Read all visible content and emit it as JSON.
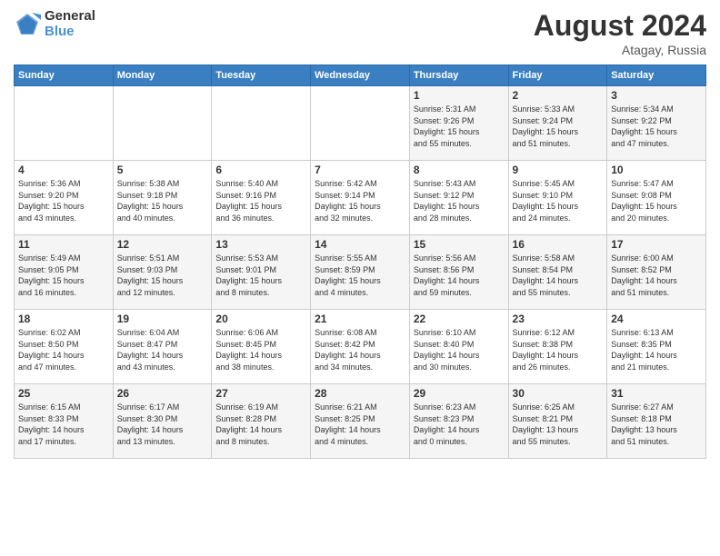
{
  "header": {
    "logo_general": "General",
    "logo_blue": "Blue",
    "month_year": "August 2024",
    "location": "Atagay, Russia"
  },
  "weekdays": [
    "Sunday",
    "Monday",
    "Tuesday",
    "Wednesday",
    "Thursday",
    "Friday",
    "Saturday"
  ],
  "weeks": [
    [
      {
        "day": "",
        "info": ""
      },
      {
        "day": "",
        "info": ""
      },
      {
        "day": "",
        "info": ""
      },
      {
        "day": "",
        "info": ""
      },
      {
        "day": "1",
        "info": "Sunrise: 5:31 AM\nSunset: 9:26 PM\nDaylight: 15 hours\nand 55 minutes."
      },
      {
        "day": "2",
        "info": "Sunrise: 5:33 AM\nSunset: 9:24 PM\nDaylight: 15 hours\nand 51 minutes."
      },
      {
        "day": "3",
        "info": "Sunrise: 5:34 AM\nSunset: 9:22 PM\nDaylight: 15 hours\nand 47 minutes."
      }
    ],
    [
      {
        "day": "4",
        "info": "Sunrise: 5:36 AM\nSunset: 9:20 PM\nDaylight: 15 hours\nand 43 minutes."
      },
      {
        "day": "5",
        "info": "Sunrise: 5:38 AM\nSunset: 9:18 PM\nDaylight: 15 hours\nand 40 minutes."
      },
      {
        "day": "6",
        "info": "Sunrise: 5:40 AM\nSunset: 9:16 PM\nDaylight: 15 hours\nand 36 minutes."
      },
      {
        "day": "7",
        "info": "Sunrise: 5:42 AM\nSunset: 9:14 PM\nDaylight: 15 hours\nand 32 minutes."
      },
      {
        "day": "8",
        "info": "Sunrise: 5:43 AM\nSunset: 9:12 PM\nDaylight: 15 hours\nand 28 minutes."
      },
      {
        "day": "9",
        "info": "Sunrise: 5:45 AM\nSunset: 9:10 PM\nDaylight: 15 hours\nand 24 minutes."
      },
      {
        "day": "10",
        "info": "Sunrise: 5:47 AM\nSunset: 9:08 PM\nDaylight: 15 hours\nand 20 minutes."
      }
    ],
    [
      {
        "day": "11",
        "info": "Sunrise: 5:49 AM\nSunset: 9:05 PM\nDaylight: 15 hours\nand 16 minutes."
      },
      {
        "day": "12",
        "info": "Sunrise: 5:51 AM\nSunset: 9:03 PM\nDaylight: 15 hours\nand 12 minutes."
      },
      {
        "day": "13",
        "info": "Sunrise: 5:53 AM\nSunset: 9:01 PM\nDaylight: 15 hours\nand 8 minutes."
      },
      {
        "day": "14",
        "info": "Sunrise: 5:55 AM\nSunset: 8:59 PM\nDaylight: 15 hours\nand 4 minutes."
      },
      {
        "day": "15",
        "info": "Sunrise: 5:56 AM\nSunset: 8:56 PM\nDaylight: 14 hours\nand 59 minutes."
      },
      {
        "day": "16",
        "info": "Sunrise: 5:58 AM\nSunset: 8:54 PM\nDaylight: 14 hours\nand 55 minutes."
      },
      {
        "day": "17",
        "info": "Sunrise: 6:00 AM\nSunset: 8:52 PM\nDaylight: 14 hours\nand 51 minutes."
      }
    ],
    [
      {
        "day": "18",
        "info": "Sunrise: 6:02 AM\nSunset: 8:50 PM\nDaylight: 14 hours\nand 47 minutes."
      },
      {
        "day": "19",
        "info": "Sunrise: 6:04 AM\nSunset: 8:47 PM\nDaylight: 14 hours\nand 43 minutes."
      },
      {
        "day": "20",
        "info": "Sunrise: 6:06 AM\nSunset: 8:45 PM\nDaylight: 14 hours\nand 38 minutes."
      },
      {
        "day": "21",
        "info": "Sunrise: 6:08 AM\nSunset: 8:42 PM\nDaylight: 14 hours\nand 34 minutes."
      },
      {
        "day": "22",
        "info": "Sunrise: 6:10 AM\nSunset: 8:40 PM\nDaylight: 14 hours\nand 30 minutes."
      },
      {
        "day": "23",
        "info": "Sunrise: 6:12 AM\nSunset: 8:38 PM\nDaylight: 14 hours\nand 26 minutes."
      },
      {
        "day": "24",
        "info": "Sunrise: 6:13 AM\nSunset: 8:35 PM\nDaylight: 14 hours\nand 21 minutes."
      }
    ],
    [
      {
        "day": "25",
        "info": "Sunrise: 6:15 AM\nSunset: 8:33 PM\nDaylight: 14 hours\nand 17 minutes."
      },
      {
        "day": "26",
        "info": "Sunrise: 6:17 AM\nSunset: 8:30 PM\nDaylight: 14 hours\nand 13 minutes."
      },
      {
        "day": "27",
        "info": "Sunrise: 6:19 AM\nSunset: 8:28 PM\nDaylight: 14 hours\nand 8 minutes."
      },
      {
        "day": "28",
        "info": "Sunrise: 6:21 AM\nSunset: 8:25 PM\nDaylight: 14 hours\nand 4 minutes."
      },
      {
        "day": "29",
        "info": "Sunrise: 6:23 AM\nSunset: 8:23 PM\nDaylight: 14 hours\nand 0 minutes."
      },
      {
        "day": "30",
        "info": "Sunrise: 6:25 AM\nSunset: 8:21 PM\nDaylight: 13 hours\nand 55 minutes."
      },
      {
        "day": "31",
        "info": "Sunrise: 6:27 AM\nSunset: 8:18 PM\nDaylight: 13 hours\nand 51 minutes."
      }
    ]
  ]
}
